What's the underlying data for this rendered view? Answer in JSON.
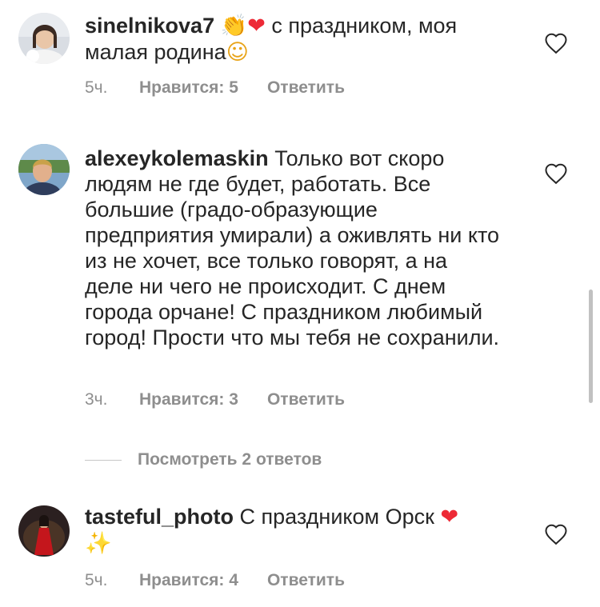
{
  "comments": [
    {
      "username": "sinelnikova7",
      "text": "с праздником, моя малая родина",
      "emoji_after_user": "👏❤",
      "emoji_after_text": "☺",
      "time": "5ч.",
      "likes": "Нравится: 5",
      "reply": "Ответить"
    },
    {
      "username": "alexeykolemaskin",
      "text": "Только вот скоро людям не где будет, работать. Все большие (градо-образующие предприятия умирали) а оживлять ни кто из не хочет, все только говорят, а на деле ни чего не происходит. С днем города орчане! С праздником любимый город! Прости что мы тебя не сохранили.",
      "time": "3ч.",
      "likes": "Нравится: 3",
      "reply": "Ответить"
    },
    {
      "username": "tasteful_photo",
      "text": "С праздником Орск",
      "emoji_after_text": "❤",
      "emoji_line2": "✨",
      "time": "5ч.",
      "likes": "Нравится: 4",
      "reply": "Ответить"
    }
  ],
  "view_replies": "Посмотреть 2 ответов",
  "colors": {
    "text": "#262626",
    "meta": "#8e8e8e",
    "heart_red": "#ed2a36",
    "sparkle_yellow": "#f5c518"
  },
  "icons": {
    "like": "heart-outline-icon"
  }
}
